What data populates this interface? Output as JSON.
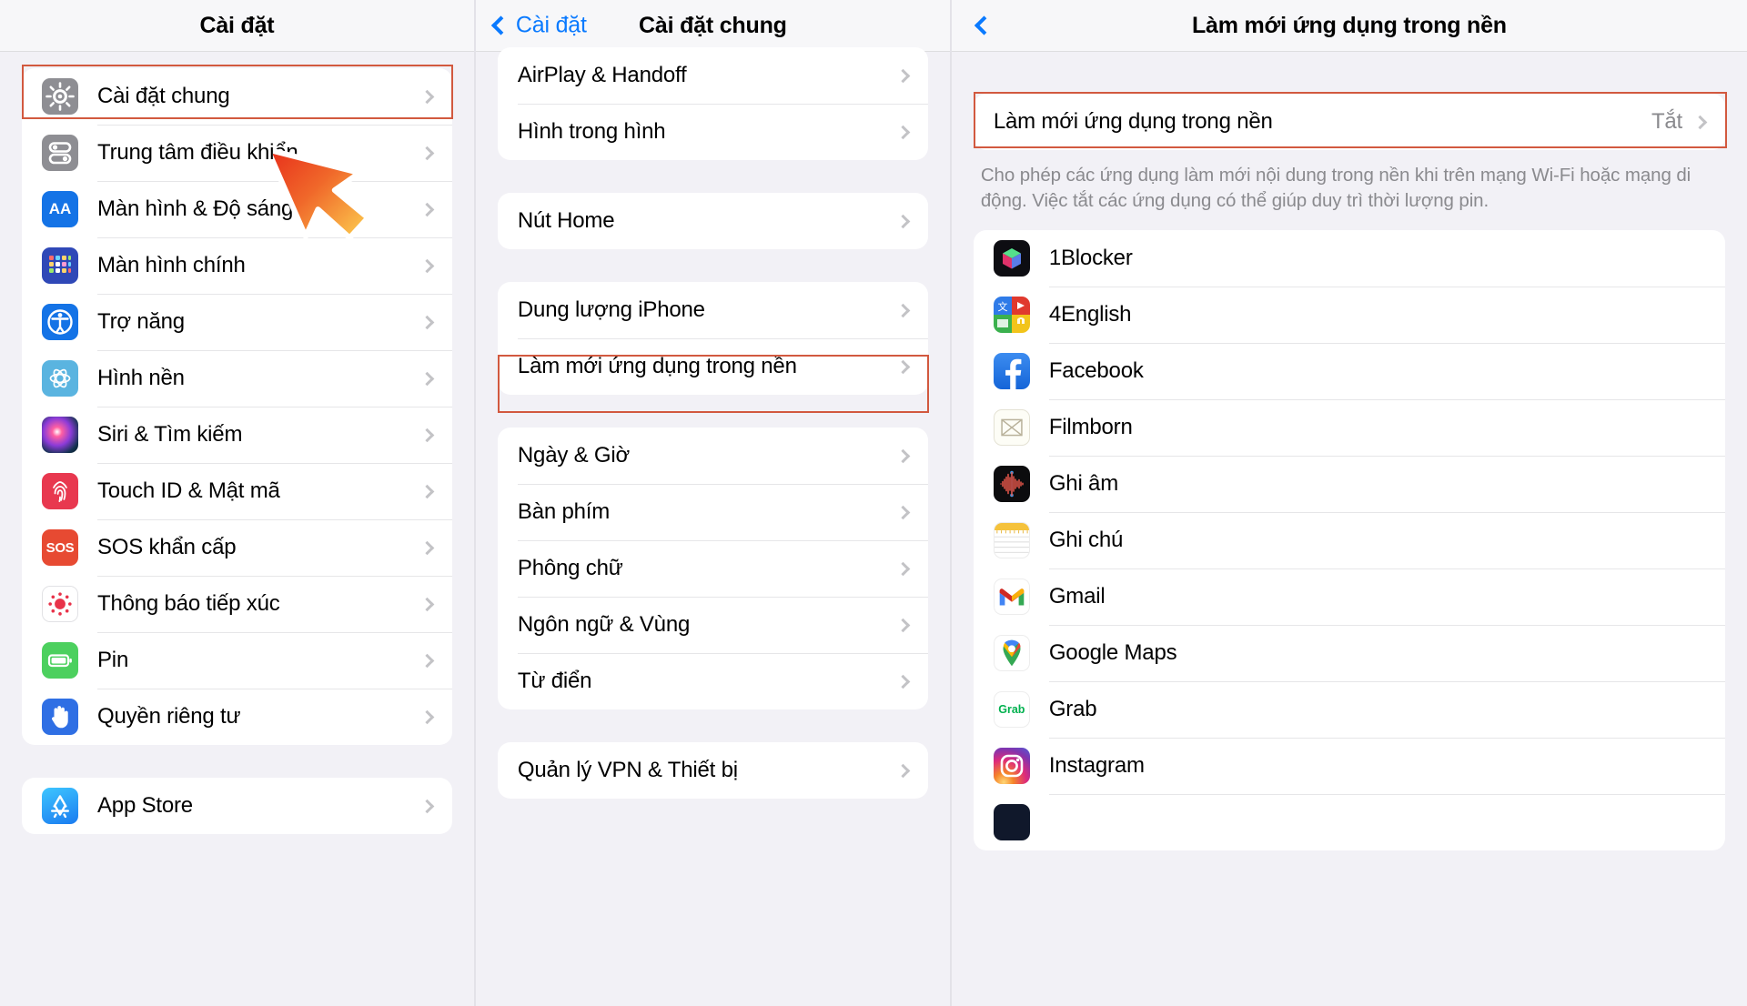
{
  "panels": {
    "left": {
      "nav": {
        "title": "Cài đặt"
      },
      "groups": [
        {
          "items": [
            {
              "label": "Cài đặt chung",
              "icon": "gear-icon",
              "highlighted": true
            },
            {
              "label": "Trung tâm điều khiển",
              "icon": "control-center-icon"
            },
            {
              "label": "Màn hình & Độ sáng",
              "icon": "display-brightness-icon"
            },
            {
              "label": "Màn hình chính",
              "icon": "home-screen-icon"
            },
            {
              "label": "Trợ năng",
              "icon": "accessibility-icon"
            },
            {
              "label": "Hình nền",
              "icon": "wallpaper-icon"
            },
            {
              "label": "Siri & Tìm kiếm",
              "icon": "siri-icon"
            },
            {
              "label": "Touch ID & Mật mã",
              "icon": "touch-id-icon"
            },
            {
              "label": "SOS khẩn cấp",
              "icon": "sos-icon"
            },
            {
              "label": "Thông báo tiếp xúc",
              "icon": "exposure-notification-icon"
            },
            {
              "label": "Pin",
              "icon": "battery-icon"
            },
            {
              "label": "Quyền riêng tư",
              "icon": "privacy-hand-icon"
            }
          ]
        },
        {
          "items": [
            {
              "label": "App Store",
              "icon": "app-store-icon"
            }
          ]
        }
      ]
    },
    "mid": {
      "nav": {
        "back_label": "Cài đặt",
        "title": "Cài đặt chung"
      },
      "groups": [
        {
          "items": [
            {
              "label": "AirPlay & Handoff"
            },
            {
              "label": "Hình trong hình"
            }
          ]
        },
        {
          "items": [
            {
              "label": "Nút Home"
            }
          ]
        },
        {
          "items": [
            {
              "label": "Dung lượng iPhone"
            },
            {
              "label": "Làm mới ứng dụng trong nền",
              "highlighted": true
            }
          ]
        },
        {
          "items": [
            {
              "label": "Ngày & Giờ"
            },
            {
              "label": "Bàn phím"
            },
            {
              "label": "Phông chữ"
            },
            {
              "label": "Ngôn ngữ & Vùng"
            },
            {
              "label": "Từ điển"
            }
          ]
        },
        {
          "items": [
            {
              "label": "Quản lý VPN & Thiết bị"
            }
          ]
        }
      ]
    },
    "right": {
      "nav": {
        "title": "Làm mới ứng dụng trong nền"
      },
      "toggle_row": {
        "label": "Làm mới ứng dụng trong nền",
        "value": "Tắt",
        "highlighted": true
      },
      "description": "Cho phép các ứng dụng làm mới nội dung trong nền khi trên mạng Wi-Fi hoặc mạng di động. Việc tắt các ứng dụng có thể giúp duy trì thời lượng pin.",
      "apps": [
        {
          "label": "1Blocker",
          "icon": "1blocker-icon"
        },
        {
          "label": "4English",
          "icon": "4english-icon"
        },
        {
          "label": "Facebook",
          "icon": "facebook-icon"
        },
        {
          "label": "Filmborn",
          "icon": "filmborn-icon"
        },
        {
          "label": "Ghi âm",
          "icon": "voice-memos-icon"
        },
        {
          "label": "Ghi chú",
          "icon": "notes-icon"
        },
        {
          "label": "Gmail",
          "icon": "gmail-icon"
        },
        {
          "label": "Google Maps",
          "icon": "google-maps-icon"
        },
        {
          "label": "Grab",
          "icon": "grab-icon"
        },
        {
          "label": "Instagram",
          "icon": "instagram-icon"
        }
      ]
    }
  },
  "colors": {
    "highlight": "#d2593f",
    "accent_blue": "#0a7aff",
    "bg": "#f2f1f6",
    "card": "#ffffff",
    "secondary_text": "#8a8a8e",
    "cursor_red": "#e8331c",
    "cursor_orange": "#f7a63a"
  },
  "cursors": [
    {
      "name": "cursor-arrow-left-panel"
    },
    {
      "name": "cursor-arrow-mid-panel"
    },
    {
      "name": "cursor-arrow-right-panel"
    }
  ]
}
